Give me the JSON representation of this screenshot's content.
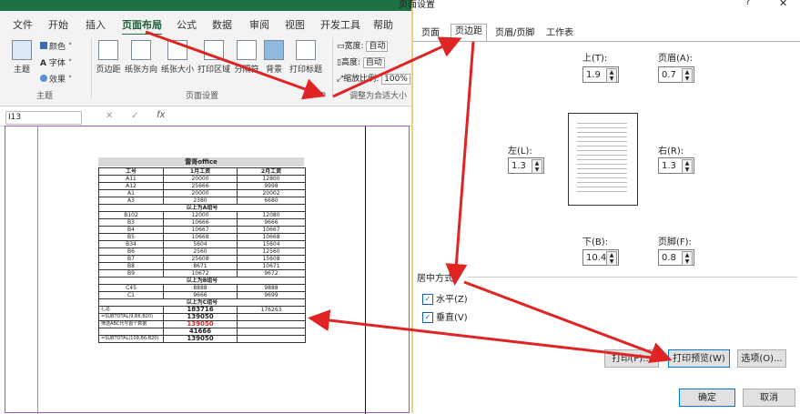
{
  "excel": {
    "title_partial": "页面设",
    "tabs": [
      "文件",
      "开始",
      "插入",
      "页面布局",
      "公式",
      "数据",
      "审阅",
      "视图",
      "开发工具",
      "帮助"
    ],
    "active_tab": "页面布局",
    "ribbon": {
      "theme": {
        "label": "主题",
        "colors": "颜色",
        "fonts": "字体",
        "effects": "效果",
        "group": "主题"
      },
      "page_setup": {
        "margins": "页边距",
        "orientation": "纸张方向",
        "size": "纸张大小",
        "print_area": "打印区域",
        "breaks": "分隔符",
        "background": "背景",
        "print_titles": "打印标题",
        "group": "页面设置"
      },
      "scale": {
        "width": "宽度:",
        "width_val": "自动",
        "height": "高度:",
        "height_val": "自动",
        "scale": "缩放比例:",
        "scale_val": "100%",
        "group": "调整为合适大小"
      }
    },
    "name_box": "I13"
  },
  "preview": {
    "title": "雷哥office",
    "headers": [
      "工号",
      "1月工资",
      "2月工资"
    ],
    "rows": [
      [
        "A11",
        "20000",
        "12800"
      ],
      [
        "A12",
        "25666",
        "9998"
      ],
      [
        "A1",
        "20000",
        "20002"
      ],
      [
        "A3",
        "2380",
        "6680"
      ],
      [
        "以上为A组号",
        "",
        ""
      ],
      [
        "B102",
        "12000",
        "12080"
      ],
      [
        "B3",
        "10666",
        "9666"
      ],
      [
        "B4",
        "10667",
        "10667"
      ],
      [
        "B5",
        "10668",
        "10668"
      ],
      [
        "B34",
        "5604",
        "15604"
      ],
      [
        "B6",
        "2560",
        "12560"
      ],
      [
        "B7",
        "25608",
        "15608"
      ],
      [
        "B8",
        "8671",
        "10671"
      ],
      [
        "B9",
        "10672",
        "9672"
      ],
      [
        "以上为B组号",
        "",
        ""
      ],
      [
        "C45",
        "8888",
        "9888"
      ],
      [
        "C1",
        "9666",
        "9699"
      ],
      [
        "以上为C组号",
        "",
        ""
      ]
    ],
    "summary": [
      [
        "汇总",
        "183716",
        "176263"
      ],
      [
        "=SUBTOTAL(9,B6:B20)",
        "139050",
        ""
      ],
      [
        "筛选ABC代号首个数据",
        "139050",
        ""
      ],
      [
        "",
        "41666",
        ""
      ],
      [
        "=SUBTOTAL(109,B6:B20)",
        "139050",
        ""
      ]
    ]
  },
  "dialog": {
    "title": "页面设置",
    "help": "?",
    "close": "✕",
    "tabs": [
      "页面",
      "页边距",
      "页眉/页脚",
      "工作表"
    ],
    "active_tab": "页边距",
    "top": {
      "label": "上(T):",
      "value": "1.9"
    },
    "header": {
      "label": "页眉(A):",
      "value": "0.7"
    },
    "left": {
      "label": "左(L):",
      "value": "1.3"
    },
    "right": {
      "label": "右(R):",
      "value": "1.3"
    },
    "bottom": {
      "label": "下(B):",
      "value": "10.4"
    },
    "footer": {
      "label": "页脚(F):",
      "value": "0.8"
    },
    "center_section": "居中方式",
    "horizontal": {
      "label": "水平(Z)",
      "checked": true
    },
    "vertical": {
      "label": "垂直(V)",
      "checked": true
    },
    "print_button": "打印(P)...",
    "preview_button": "打印预览(W)",
    "options_button": "选项(O)...",
    "ok_button": "确定",
    "cancel_button": "取消"
  },
  "colors": {
    "excel_green": "#1e7145",
    "arrow_red": "#e02424",
    "preview_border": "#9a58c8"
  }
}
